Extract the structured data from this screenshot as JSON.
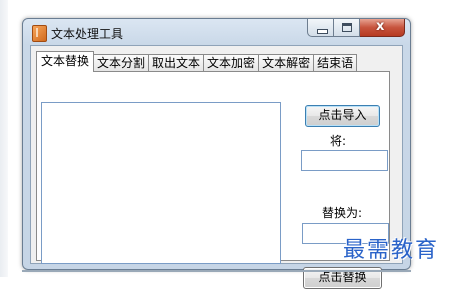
{
  "window": {
    "title": "文本处理工具",
    "icon": "app-book-icon"
  },
  "caption": {
    "minimize_icon": "minimize-icon",
    "maximize_icon": "maximize-icon",
    "close_glyph": "x"
  },
  "tabs": [
    {
      "label": "文本替换",
      "active": true
    },
    {
      "label": "文本分割",
      "active": false
    },
    {
      "label": "取出文本",
      "active": false
    },
    {
      "label": "文本加密",
      "active": false
    },
    {
      "label": "文本解密",
      "active": false
    },
    {
      "label": "结束语",
      "active": false
    }
  ],
  "panel": {
    "import_button": "点击导入",
    "from_label": "将:",
    "from_value": "",
    "to_label": "替换为:",
    "to_value": "",
    "replace_button": "点击替换",
    "text_content": ""
  },
  "watermark": "最需教育"
}
